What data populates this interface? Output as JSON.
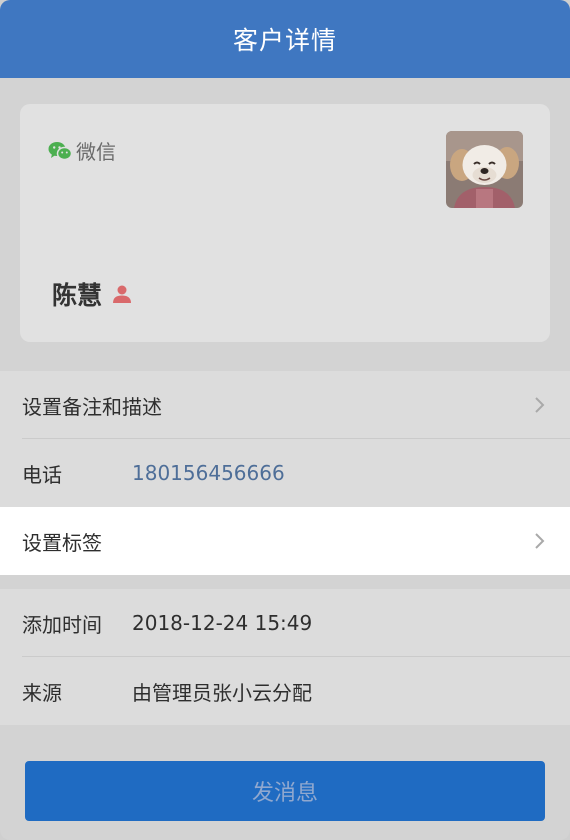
{
  "header": {
    "title": "客户详情"
  },
  "card": {
    "source_label": "微信",
    "name": "陈慧",
    "avatar_icon": "dog-photo-avatar"
  },
  "info": {
    "remark_label": "设置备注和描述",
    "phone_label": "电话",
    "phone_value": "180156456666",
    "tag_label": "设置标签"
  },
  "meta": {
    "added_label": "添加时间",
    "added_value": "2018-12-24 15:49",
    "source_label": "来源",
    "source_value": "由管理员张小云分配"
  },
  "actions": {
    "send_label": "发消息"
  },
  "colors": {
    "header": "#3f77c1",
    "button": "#1f6bc2",
    "wechat_green": "#4caf50",
    "gender_red": "#d9696b",
    "phone_link": "#4e6e98"
  }
}
